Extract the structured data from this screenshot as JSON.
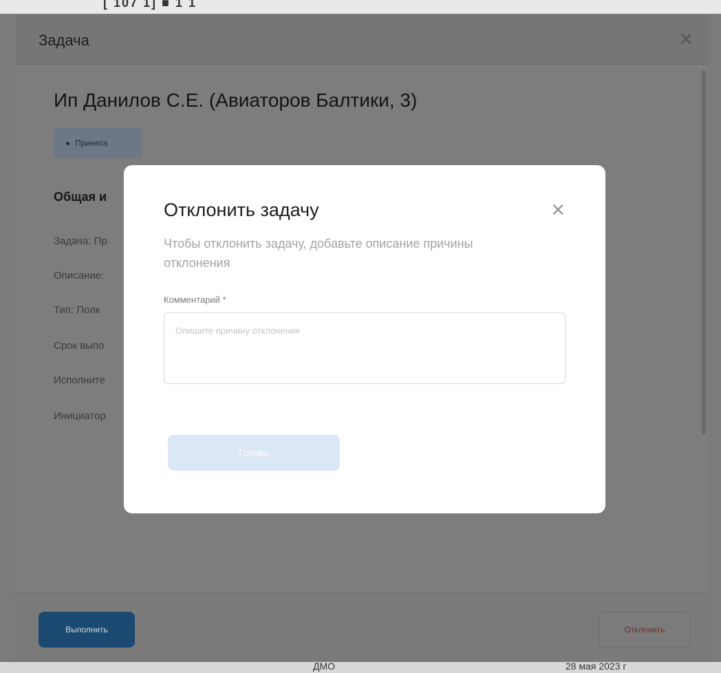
{
  "background": {
    "top_fragment": "[ 107 1] ■ 1 1",
    "bottom_left": "ДМО",
    "bottom_right": "28 мая 2023 г"
  },
  "task_window": {
    "header_title": "Задача",
    "title": "Ип Данилов С.Е. (Авиаторов Балтики, 3)",
    "status": "Принята",
    "section_title": "Общая и",
    "fields": [
      "Задача: Пр",
      "Описание:",
      "Тип: Полк",
      "Срок выпо",
      "Исполните",
      "Инициатор"
    ],
    "execute_label": "Выполнить",
    "reject_label": "Отклонить"
  },
  "modal": {
    "title": "Отклонить задачу",
    "subtitle": "Чтобы отклонить задачу, добавьте описание причины отклонения",
    "comment_label": "Комментарий *",
    "comment_placeholder": "Опишите причину отклонения",
    "done_label": "Готово"
  },
  "colors": {
    "accent": "#1a4a72",
    "danger": "#c0392b",
    "disabled_button": "#dbe6f6"
  }
}
